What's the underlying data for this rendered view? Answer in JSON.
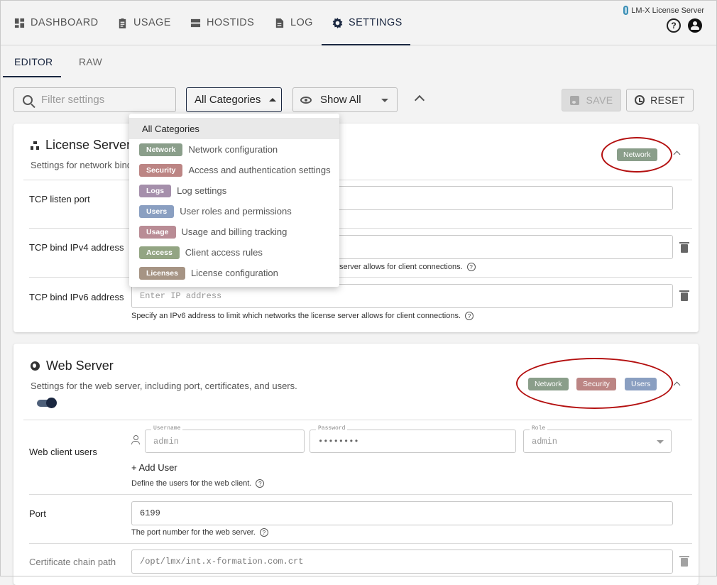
{
  "nav": {
    "dashboard": "DASHBOARD",
    "usage": "USAGE",
    "hostids": "HOSTIDS",
    "log": "LOG",
    "settings": "SETTINGS"
  },
  "brand": {
    "title": "LM-X License Server"
  },
  "subtabs": {
    "editor": "EDITOR",
    "raw": "RAW"
  },
  "toolbar": {
    "filter_placeholder": "Filter settings",
    "category_value": "All Categories",
    "show_value": "Show All",
    "save_label": "SAVE",
    "reset_label": "RESET"
  },
  "dropdown": {
    "header": "All Categories",
    "items": [
      {
        "badge": "Network",
        "text": "Network configuration"
      },
      {
        "badge": "Security",
        "text": "Access and authentication settings"
      },
      {
        "badge": "Logs",
        "text": "Log settings"
      },
      {
        "badge": "Users",
        "text": "User roles and permissions"
      },
      {
        "badge": "Usage",
        "text": "Usage and billing tracking"
      },
      {
        "badge": "Access",
        "text": "Client access rules"
      },
      {
        "badge": "Licenses",
        "text": "License configuration"
      }
    ]
  },
  "license_server": {
    "title": "License Server",
    "desc": "Settings for network bind",
    "badges": [
      "Network"
    ],
    "rows": {
      "tcp_port_label": "TCP listen port",
      "ipv4_label": "TCP bind IPv4 address",
      "ipv4_hint": "server allows for client connections.",
      "ipv6_label": "TCP bind IPv6 address",
      "ipv6_placeholder": "Enter IP address",
      "ipv6_hint": "Specify an IPv6 address to limit which networks the license server allows for client connections."
    }
  },
  "web_server": {
    "title": "Web Server",
    "desc": "Settings for the web server, including port, certificates, and users.",
    "badges": [
      "Network",
      "Security",
      "Users"
    ],
    "users": {
      "label": "Web client users",
      "username_legend": "Username",
      "username_value": "admin",
      "password_legend": "Password",
      "password_value": "••••••••",
      "role_legend": "Role",
      "role_value": "admin",
      "add_user": "+ Add User",
      "hint": "Define the users for the web client."
    },
    "port": {
      "label": "Port",
      "value": "6199",
      "hint": "The port number for the web server."
    },
    "cert": {
      "label": "Certificate chain path",
      "value": "/opt/lmx/int.x-formation.com.crt"
    }
  },
  "icons": {
    "dashboard": "dashboard-icon",
    "usage": "clipboard-icon",
    "hostids": "server-icon",
    "log": "document-icon",
    "settings": "gear-icon",
    "help": "help-icon",
    "account": "account-icon"
  },
  "colors": {
    "accent": "#1a2740",
    "annotation": "#b41010",
    "network": "#8a9e8a",
    "security": "#bc8584",
    "users": "#8a9fc1",
    "logs": "#a58fab",
    "usage": "#b98c95",
    "access": "#93a583",
    "licenses": "#a69484"
  }
}
